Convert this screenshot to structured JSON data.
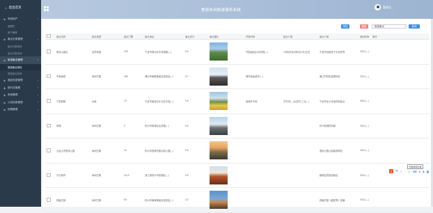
{
  "sidebar": {
    "brand": "后台首页",
    "items": [
      {
        "label": "系统用户",
        "icon": "user-icon",
        "active": false
      },
      {
        "label": "管理员",
        "sub": true,
        "active": false
      },
      {
        "label": "用户管理",
        "sub": true,
        "active": false
      },
      {
        "label": "景点分类管理",
        "icon": "list-icon",
        "active": false
      },
      {
        "label": "景点分类添加",
        "sub": true,
        "active": false
      },
      {
        "label": "景点分类查询",
        "sub": true,
        "active": false
      },
      {
        "label": "旅游景点管理",
        "icon": "picture-icon",
        "active": true
      },
      {
        "label": "旅游景点添加",
        "sub": true,
        "active": true
      },
      {
        "label": "旅游景点查询",
        "sub": true,
        "active": false
      },
      {
        "label": "酒店信息管理",
        "icon": "building-icon",
        "active": false
      },
      {
        "label": "旅行社管理",
        "icon": "flag-icon",
        "active": false
      },
      {
        "label": "系统管理",
        "icon": "gear-icon",
        "active": false
      },
      {
        "label": "公告信息管理",
        "icon": "bell-icon",
        "active": false
      },
      {
        "label": "权限管理",
        "icon": "lock-icon",
        "active": false
      }
    ]
  },
  "header": {
    "title": "美丽休闲旅游服务系统",
    "username": "管理员"
  },
  "toolbar": {
    "add": "添加",
    "delete": "删除",
    "search_value": "旅游景点",
    "search": "查询",
    "colors": {
      "add": "#3d8fe0",
      "delete": "#f08080",
      "search": "#3d8fe0"
    }
  },
  "table": {
    "columns": [
      "景点名称",
      "景点类型",
      "景点门票",
      "景点地址",
      "景点评分",
      "景点图片",
      "开放时间",
      "景点介绍",
      "景点介绍",
      "添加时间",
      "操作"
    ],
    "rows": [
      {
        "name": "黄龙山景区",
        "type": "自然风景",
        "price": "139",
        "address": "宁波市鄞州区东钱湖镇(...)",
        "score": "5.6",
        "open": "开园(最佳)4月份到(...)",
        "intro1": "1月份前往6到9(月 份)左右",
        "intro2": "宁波东钱湖位于大自然界",
        "date": "2021-(...)",
        "img": "mountain"
      },
      {
        "name": "华南景观",
        "type": "休闲古镇",
        "price": "186",
        "address": "浦州市南都镇景区旅游区(...)",
        "score": "5.7",
        "open": "湖开始运营开(...)",
        "intro1": "",
        "intro2": "南江村特色景观特征",
        "date": "2021-(...)",
        "img": "building"
      },
      {
        "name": "宁国城楼",
        "type": "水库",
        "price": "19",
        "address": "宁波市南安区北仑区东地(...)",
        "score": "6.6",
        "open": "高速开不到",
        "intro1": "不可完(...)大连湾,三大(...)",
        "intro2": "宁波市北仑本地特色景点",
        "date": "2021-(...)",
        "img": "lake"
      },
      {
        "name": "西湖",
        "type": "休闲古镇",
        "price": "0",
        "address": "杭州市西湖区龙井路(...)",
        "score": "5.8",
        "open": "",
        "intro1": "",
        "intro2": "杭州西湖的风景",
        "date": "2021-(...)",
        "img": "tower"
      },
      {
        "name": "大运山湾湿地公园",
        "type": "休闲古镇",
        "price": "15",
        "address": "杭州市西湖东路大新公园(...)",
        "score": "5.5",
        "open": "",
        "intro1": "",
        "intro2": "湿地公园公园景观特色",
        "date": "2021-(...)",
        "img": "sunset"
      },
      {
        "name": "开元城市",
        "type": "休闲古镇",
        "price": "111.0",
        "address": "浙江省杭州市西湖区(...)",
        "score": "5.5",
        "open": "",
        "intro1": "",
        "intro2": "越城区的旅游景区",
        "date": "2021-(...)",
        "img": "pagoda"
      },
      {
        "name": "西塘古镇",
        "type": "休闲古镇",
        "price": "95",
        "address": "杭州市南海镇景区旅游区(...)",
        "score": "4.2",
        "open": "",
        "intro1": "",
        "intro2": "西塘古镇《盛夏季》西塘",
        "date": "2021-(...)",
        "img": "temple"
      }
    ],
    "actions": {
      "edit": "修改",
      "detail": "查看详情",
      "edit_color": "#3fa9e6",
      "detail_color": "#f5a623"
    }
  },
  "floating_toolbar": {
    "logo": "S",
    "tooltip": "开放搜索引擎"
  }
}
